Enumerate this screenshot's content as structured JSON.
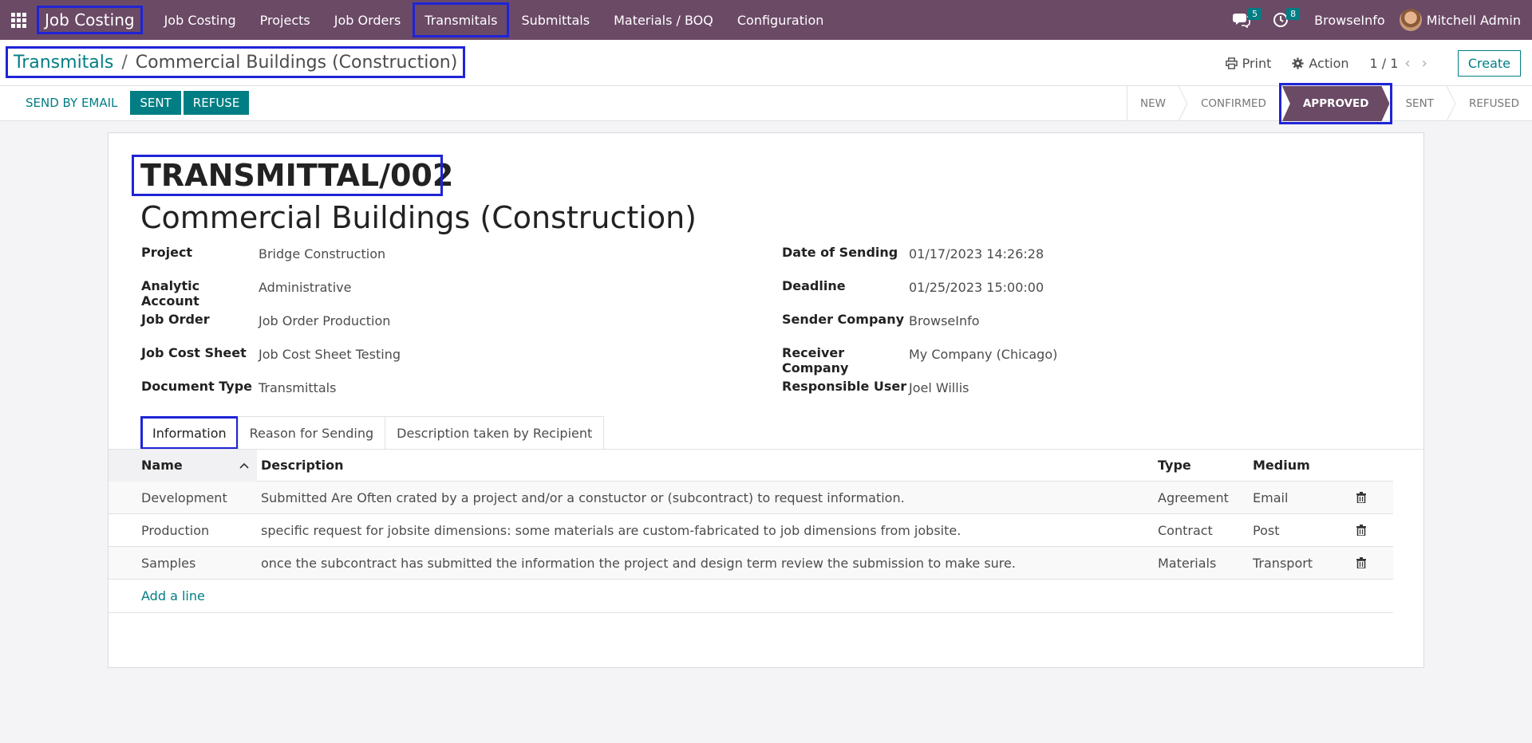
{
  "navbar": {
    "brand": "Job Costing",
    "menu": [
      "Job Costing",
      "Projects",
      "Job Orders",
      "Transmitals",
      "Submittals",
      "Materials / BOQ",
      "Configuration"
    ],
    "messages_count": "5",
    "activities_count": "8",
    "company": "BrowseInfo",
    "user": "Mitchell Admin"
  },
  "breadcrumb": {
    "parent": "Transmitals",
    "separator": "/",
    "current": "Commercial Buildings (Construction)"
  },
  "control": {
    "print": "Print",
    "action": "Action",
    "pager": "1 / 1",
    "create": "Create"
  },
  "actions": {
    "send_email": "SEND BY EMAIL",
    "sent": "SENT",
    "refuse": "REFUSE"
  },
  "stages": [
    "NEW",
    "CONFIRMED",
    "APPROVED",
    "SENT",
    "REFUSED"
  ],
  "active_stage": "APPROVED",
  "record": {
    "reference": "TRANSMITTAL/002",
    "title": "Commercial Buildings (Construction)",
    "left_fields": [
      {
        "label": "Project",
        "value": "Bridge Construction"
      },
      {
        "label": "Analytic Account",
        "value": "Administrative"
      },
      {
        "label": "Job Order",
        "value": "Job Order Production"
      },
      {
        "label": "Job Cost Sheet",
        "value": "Job Cost Sheet Testing"
      },
      {
        "label": "Document Type",
        "value": "Transmittals"
      }
    ],
    "right_fields": [
      {
        "label": "Date of Sending",
        "value": "01/17/2023 14:26:28"
      },
      {
        "label": "Deadline",
        "value": "01/25/2023 15:00:00"
      },
      {
        "label": "Sender Company",
        "value": "BrowseInfo"
      },
      {
        "label": "Receiver Company",
        "value": "My Company (Chicago)"
      },
      {
        "label": "Responsible User",
        "value": "Joel Willis"
      }
    ]
  },
  "tabs": [
    "Information",
    "Reason for Sending",
    "Description taken by Recipient"
  ],
  "table": {
    "columns": [
      "Name",
      "Description",
      "Type",
      "Medium"
    ],
    "rows": [
      {
        "name": "Development",
        "description": "Submitted Are Often crated by a project and/or a constuctor or (subcontract) to request information.",
        "type": "Agreement",
        "medium": "Email"
      },
      {
        "name": "Production",
        "description": "specific request for jobsite dimensions: some materials are custom-fabricated to job dimensions from jobsite.",
        "type": "Contract",
        "medium": "Post"
      },
      {
        "name": "Samples",
        "description": "once the subcontract has submitted the information the project and design term review the submission to make sure.",
        "type": "Materials",
        "medium": "Transport"
      }
    ],
    "add_line": "Add a line"
  },
  "colors": {
    "navbar": "#6b4a66",
    "accent": "#017e84",
    "highlight": "#1f24d6"
  }
}
